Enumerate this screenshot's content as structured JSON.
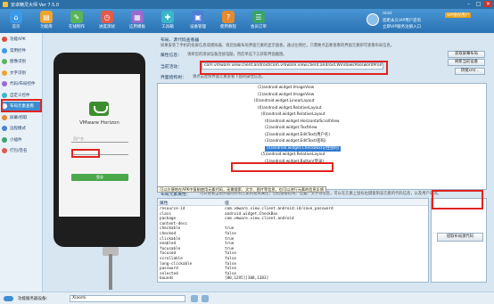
{
  "window": {
    "title": "安卓精灵大师 Ver 7.5.0"
  },
  "toolbar": {
    "items": [
      {
        "label": "首页",
        "color": "#3b9ae8",
        "icon": "home-icon"
      },
      {
        "label": "功能库",
        "color": "#f0a330",
        "icon": "library-icon"
      },
      {
        "label": "在线制作",
        "color": "#5ab55a",
        "icon": "online-make-icon"
      },
      {
        "label": "进度测试",
        "color": "#e25b4a",
        "icon": "progress-test-icon"
      },
      {
        "label": "应用模板",
        "color": "#9b6ad0",
        "icon": "template-icon"
      },
      {
        "label": "工具箱",
        "color": "#3cb6c8",
        "icon": "toolbox-icon"
      },
      {
        "label": "设备管理",
        "color": "#4d7fd6",
        "icon": "device-icon"
      },
      {
        "label": "使用教程",
        "color": "#e38b2e",
        "icon": "tutorial-icon"
      },
      {
        "label": "会员订单",
        "color": "#3aa36b",
        "icon": "member-order-icon"
      }
    ]
  },
  "user": {
    "name": "mint",
    "vip_badge": "VIP授权用户",
    "line1": "您距永久VIP用户还有",
    "line2": "立即VIP服务注册入口"
  },
  "sidebar": {
    "items": [
      {
        "label": "功能APK",
        "color": "#e24a3b"
      },
      {
        "label": "常用控件",
        "color": "#3b9ae8"
      },
      {
        "label": "图像识别",
        "color": "#5ab55a"
      },
      {
        "label": "文字识别",
        "color": "#f0a330"
      },
      {
        "label": "代码/布局控件",
        "color": "#9b6ad0"
      },
      {
        "label": "自定义控件",
        "color": "#3cb6c8"
      },
      {
        "label": "布局元素查看",
        "color": "#ffffff"
      },
      {
        "label": "屏幕/抓取",
        "color": "#e38b2e"
      },
      {
        "label": "远程模式",
        "color": "#4d7fd6"
      },
      {
        "label": "小插件",
        "color": "#3aa36b"
      },
      {
        "label": "打包/签名",
        "color": "#e25b4a"
      }
    ]
  },
  "phone": {
    "app_title": "VMware Horizon",
    "username_placeholder": "用户名",
    "password_value": "******",
    "login_label": "登录"
  },
  "panel": {
    "header_label": "布局、源代码查看器",
    "header_note": "如果安装了手机的投屏信息或模拟器，请您加载布局界面元素的显示面板，通过左侧栏，只需要点击要查看的界面元素即可查看布局信息。",
    "attr_label": "属性信息：",
    "attr_note": "请将您的测试设备连接电脑，然后单击下方获取界面截图。",
    "fetch_button": "获取屏幕布局",
    "load_button": "刷新当前设备",
    "current_label": "当前活动：",
    "activity_value": "com.vmware.view.client.android/com.vmware.view.client.android.WindowsPasswordPrompt",
    "dump_button": "转储xml...",
    "layout_label": "界面结构树：",
    "layout_note": "请点击左侧界面元素查看下面的属性信息。",
    "tree": [
      {
        "text": "(1)android.widget.ImageView"
      },
      {
        "text": "(1)android.widget.ImageView"
      },
      {
        "text": "(0)android.widget.LinearLayout"
      },
      {
        "text": "(0)android.widget.RelativeLayout"
      },
      {
        "text": "(0)android.widget.RelativeLayout"
      },
      {
        "text": "(0)android.widget.HorizontalScrollView"
      },
      {
        "text": "(1)android.widget.TextView"
      },
      {
        "text": "(2)android.widget.EditText(用户名)"
      },
      {
        "text": "(3)android.widget.EditText(密码)"
      },
      {
        "text": "(4)android.widget.CheckBox(记住密码)"
      },
      {
        "text": "(5)android.widget.RelativeLayout"
      },
      {
        "text": "(1)android.widget.Button(登录)"
      }
    ],
    "element_label": "布局元素属性：",
    "element_note": "可以查看当前界面的所有元素的相关属性，包括层级结构、位置、文字等信息，可以在元素上鼠标右键复制该元素的代码信息，以及用户调试。",
    "tooltip": "可以方便地在APK中复制使用元素代码，无需搜索、文字、图片等信息，也可以进行元素的信息反馈",
    "props_header": [
      "属性",
      "值"
    ],
    "props": [
      {
        "k": "resource-id",
        "v": "com.vmware.view.client.android:id/save_password"
      },
      {
        "k": "class",
        "v": "android.widget.CheckBox"
      },
      {
        "k": "package",
        "v": "com.vmware.view.client.android"
      },
      {
        "k": "content-desc",
        "v": ""
      },
      {
        "k": "checkable",
        "v": "true"
      },
      {
        "k": "checked",
        "v": "false"
      },
      {
        "k": "clickable",
        "v": "true"
      },
      {
        "k": "enabled",
        "v": "true"
      },
      {
        "k": "focusable",
        "v": "true"
      },
      {
        "k": "focused",
        "v": "false"
      },
      {
        "k": "scrollable",
        "v": "false"
      },
      {
        "k": "long-clickable",
        "v": "false"
      },
      {
        "k": "password",
        "v": "false"
      },
      {
        "k": "selected",
        "v": "false"
      },
      {
        "k": "bounds",
        "v": "[80,1295][308,1383]"
      }
    ],
    "copy_button": "提取布局源代码"
  },
  "status": {
    "mode_label": "功能服务器设备：",
    "device_value": "Xiaomi"
  }
}
